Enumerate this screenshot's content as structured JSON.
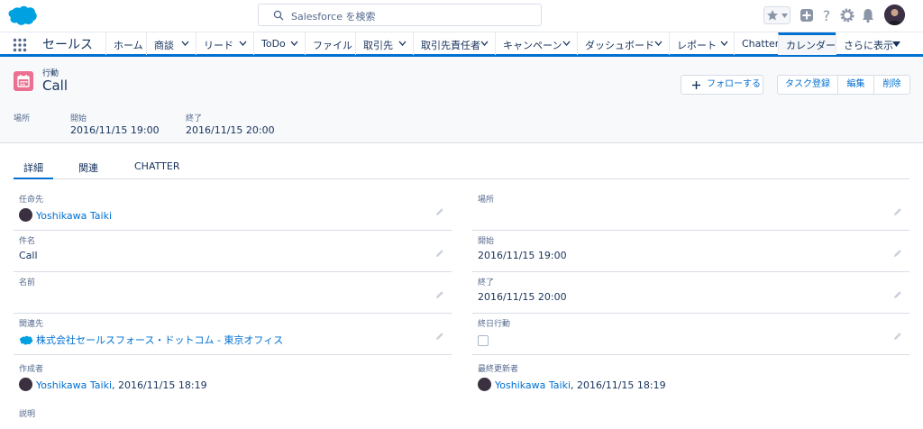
{
  "header": {
    "search_placeholder": "Salesforce を検索"
  },
  "nav": {
    "app_name": "セールス",
    "items": [
      {
        "label": "ホーム"
      },
      {
        "label": "商談"
      },
      {
        "label": "リード"
      },
      {
        "label": "ToDo"
      },
      {
        "label": "ファイル"
      },
      {
        "label": "取引先"
      },
      {
        "label": "取引先責任者"
      },
      {
        "label": "キャンペーン"
      },
      {
        "label": "ダッシュボード"
      },
      {
        "label": "レポート"
      },
      {
        "label": "Chatter"
      },
      {
        "label": "カレンダー"
      },
      {
        "label": "さらに表示"
      }
    ]
  },
  "record": {
    "type": "行動",
    "title": "Call",
    "follow_label": "フォローする",
    "actions": [
      "タスク登録",
      "編集",
      "削除"
    ]
  },
  "highlights": [
    {
      "label": "場所",
      "value": ""
    },
    {
      "label": "開始",
      "value": "2016/11/15 19:00"
    },
    {
      "label": "終了",
      "value": "2016/11/15 20:00"
    }
  ],
  "tabs": [
    "詳細",
    "関連",
    "CHATTER"
  ],
  "fields": {
    "assigned": {
      "label": "任命先",
      "value": "Yoshikawa Taiki"
    },
    "location": {
      "label": "場所",
      "value": ""
    },
    "subject": {
      "label": "件名",
      "value": "Call"
    },
    "start": {
      "label": "開始",
      "value": "2016/11/15 19:00"
    },
    "name": {
      "label": "名前",
      "value": ""
    },
    "end": {
      "label": "終了",
      "value": "2016/11/15 20:00"
    },
    "related": {
      "label": "関連先",
      "value": "株式会社セールスフォース・ドットコム - 東京オフィス"
    },
    "allday": {
      "label": "終日行動",
      "checked": false
    },
    "created": {
      "label": "作成者",
      "user": "Yoshikawa Taiki",
      "date": ", 2016/11/15 18:19"
    },
    "modified": {
      "label": "最終更新者",
      "user": "Yoshikawa Taiki",
      "date": ", 2016/11/15 18:19"
    },
    "description": {
      "label": "説明"
    }
  },
  "colors": {
    "brand": "#0070d2",
    "event_icon": "#eb7092"
  }
}
